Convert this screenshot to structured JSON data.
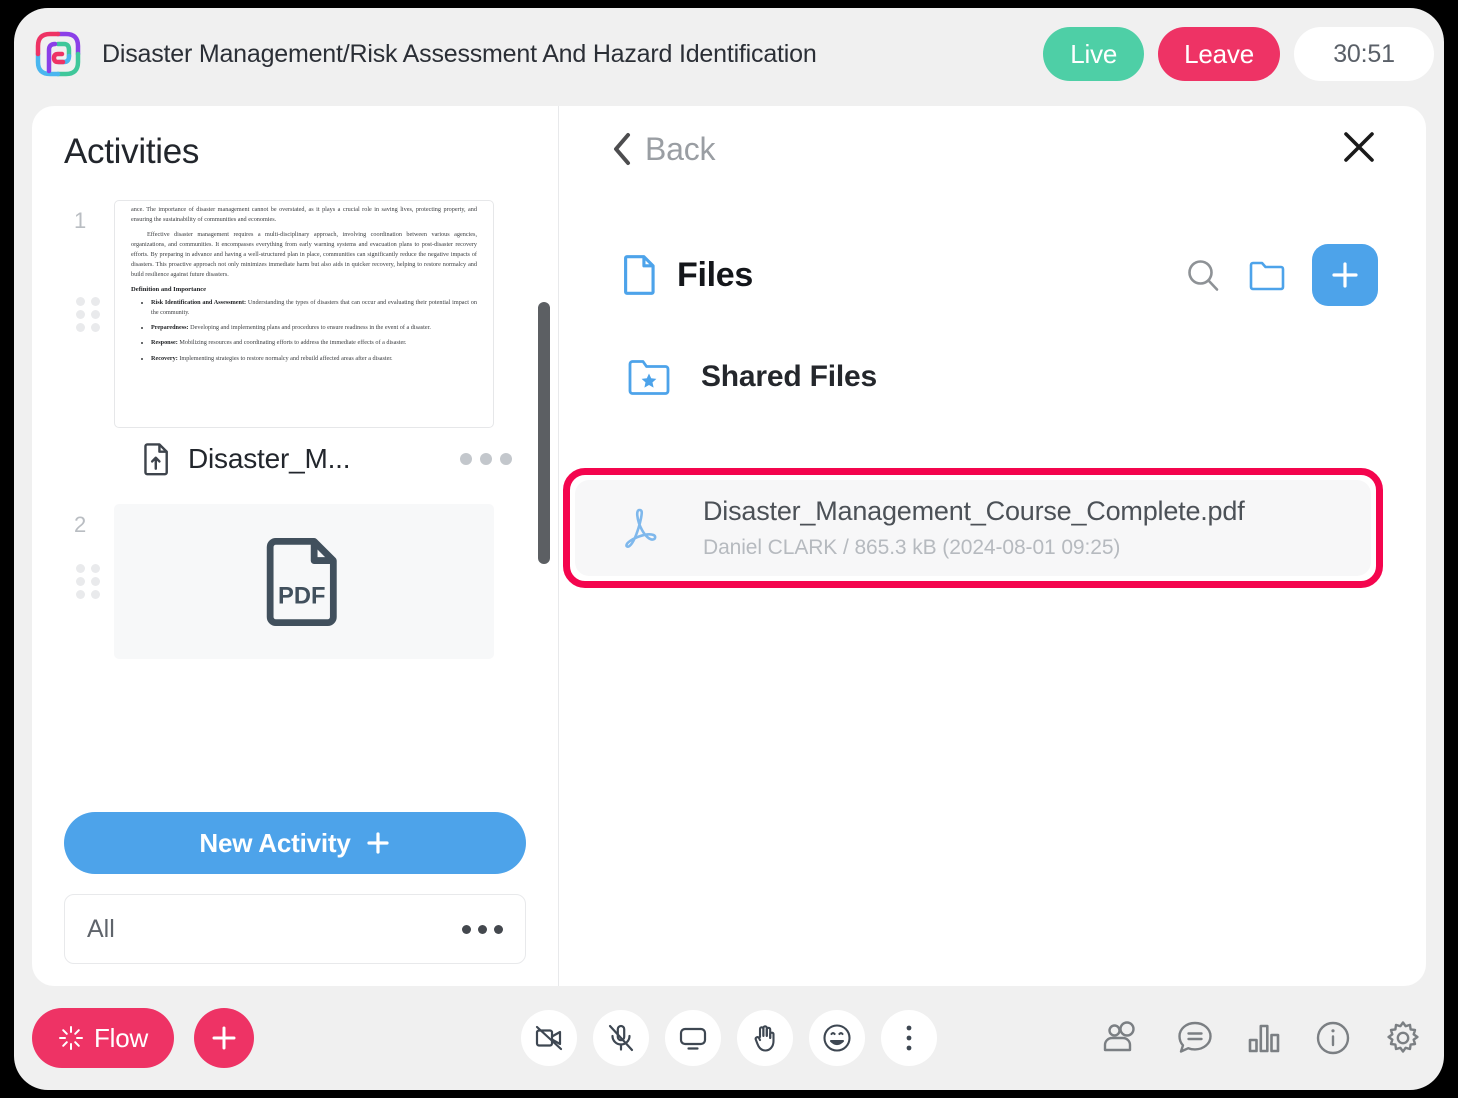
{
  "header": {
    "logo_icon": "pelcro-spiral-logo",
    "title": "Disaster Management/Risk Assessment And Hazard Identification",
    "live_label": "Live",
    "leave_label": "Leave",
    "timer": "30:51"
  },
  "activities": {
    "title": "Activities",
    "items": [
      {
        "index": "1",
        "type": "document",
        "label": "Disaster_M...",
        "icon": "file-upload-icon",
        "handle_icon": "drag-handle-icon",
        "more_icon": "more-horizontal-icon",
        "document_preview": {
          "para1": "ance. The importance of disaster management cannot be overstated, as it plays a crucial role in saving lives, protecting property, and ensuring the sustainability of communities and economies.",
          "para2": "Effective disaster management requires a multi-disciplinary approach, involving coordination between various agencies, organizations, and communities. It encompasses everything from early warning systems and evacuation plans to post-disaster recovery efforts. By preparing in advance and having a well-structured plan in place, communities can significantly reduce the negative impacts of disasters. This proactive approach not only minimizes immediate harm but also aids in quicker recovery, helping to restore normalcy and build resilience against future disasters.",
          "heading": "Definition and Importance",
          "bullets": [
            {
              "term": "Risk Identification and Assessment:",
              "text": " Understanding the types of disasters that can occur and evaluating their potential impact on the community."
            },
            {
              "term": "Preparedness:",
              "text": " Developing and implementing plans and procedures to ensure readiness in the event of a disaster."
            },
            {
              "term": "Response:",
              "text": " Mobilizing resources and coordinating efforts to address the immediate effects of a disaster."
            },
            {
              "term": "Recovery:",
              "text": " Implementing strategies to restore normalcy and rebuild affected areas after a disaster."
            }
          ]
        }
      },
      {
        "index": "2",
        "type": "pdf",
        "thumb_icon": "pdf-file-icon",
        "thumb_label": "PDF",
        "handle_icon": "drag-handle-icon"
      }
    ],
    "new_activity_label": "New Activity",
    "new_activity_icon": "plus-icon",
    "filter_value": "All",
    "filter_more_icon": "more-horizontal-icon"
  },
  "files_panel": {
    "back_label": "Back",
    "back_icon": "chevron-left-icon",
    "close_icon": "close-icon",
    "title": "Files",
    "title_icon": "file-icon",
    "search_icon": "search-icon",
    "new_folder_icon": "folder-icon",
    "add_icon": "plus-icon",
    "folders": [
      {
        "name": "Shared Files",
        "icon": "folder-star-icon"
      }
    ],
    "files": [
      {
        "name": "Disaster_Management_Course_Complete.pdf",
        "owner": "Daniel CLARK",
        "size": "865.3 kB",
        "date": "(2024-08-01 09:25)",
        "separator": "/",
        "icon": "pdf-adobe-icon",
        "highlighted": true
      }
    ]
  },
  "bottom_bar": {
    "flow_label": "Flow",
    "flow_icon": "sparkle-icon",
    "add_icon": "plus-icon",
    "center_tools": [
      {
        "name": "camera-off-icon"
      },
      {
        "name": "microphone-off-icon"
      },
      {
        "name": "screen-share-icon"
      },
      {
        "name": "raise-hand-icon"
      },
      {
        "name": "emoji-icon"
      },
      {
        "name": "more-vertical-icon"
      }
    ],
    "right_tools": [
      {
        "name": "participants-icon"
      },
      {
        "name": "chat-icon"
      },
      {
        "name": "poll-icon"
      },
      {
        "name": "info-icon"
      },
      {
        "name": "settings-icon"
      }
    ]
  },
  "annotation": {
    "arrow_icon": "pointer-arrow-icon",
    "highlight_color": "#f4054e"
  },
  "colors": {
    "accent_blue": "#4da3ea",
    "live_green": "#4ecfa6",
    "leave_pink": "#ee3365",
    "highlight": "#f4054e"
  }
}
